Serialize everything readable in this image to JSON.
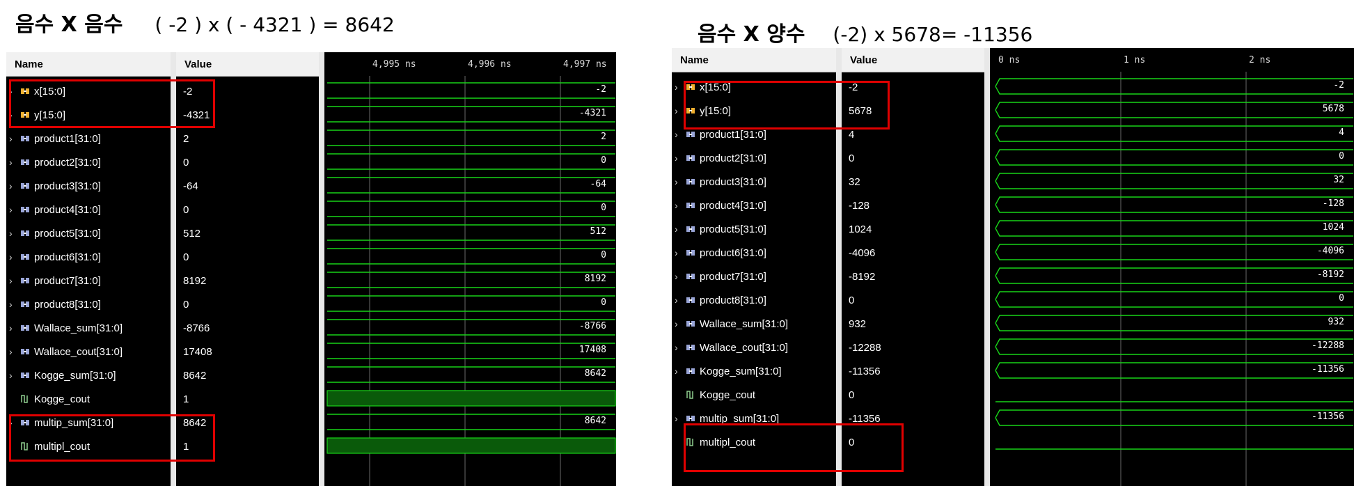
{
  "left": {
    "heading_kr": "음수 X 음수",
    "heading_eq": "( -2 ) x ( - 4321 ) = 8642",
    "columns": {
      "name": "Name",
      "value": "Value"
    },
    "ruler_labels": [
      "4,995 ns",
      "4,996 ns",
      "4,997 ns"
    ],
    "signals": [
      {
        "name": "x[15:0]",
        "value": "-2",
        "wave": "-2"
      },
      {
        "name": "y[15:0]",
        "value": "-4321",
        "wave": "-4321"
      },
      {
        "name": "product1[31:0]",
        "value": "2",
        "wave": "2"
      },
      {
        "name": "product2[31:0]",
        "value": "0",
        "wave": "0"
      },
      {
        "name": "product3[31:0]",
        "value": "-64",
        "wave": "-64"
      },
      {
        "name": "product4[31:0]",
        "value": "0",
        "wave": "0"
      },
      {
        "name": "product5[31:0]",
        "value": "512",
        "wave": "512"
      },
      {
        "name": "product6[31:0]",
        "value": "0",
        "wave": "0"
      },
      {
        "name": "product7[31:0]",
        "value": "8192",
        "wave": "8192"
      },
      {
        "name": "product8[31:0]",
        "value": "0",
        "wave": "0"
      },
      {
        "name": "Wallace_sum[31:0]",
        "value": "-8766",
        "wave": "-8766"
      },
      {
        "name": "Wallace_cout[31:0]",
        "value": "17408",
        "wave": "17408"
      },
      {
        "name": "Kogge_sum[31:0]",
        "value": "8642",
        "wave": "8642"
      },
      {
        "name": "Kogge_cout",
        "value": "1",
        "wave": ""
      },
      {
        "name": "multip_sum[31:0]",
        "value": "8642",
        "wave": "8642"
      },
      {
        "name": "multipl_cout",
        "value": "1",
        "wave": ""
      }
    ]
  },
  "right": {
    "heading_kr": "음수 X 양수",
    "heading_eq": "(-2) x 5678=  -11356",
    "columns": {
      "name": "Name",
      "value": "Value"
    },
    "ruler_labels": [
      "0 ns",
      "1 ns",
      "2 ns"
    ],
    "signals": [
      {
        "name": "x[15:0]",
        "value": "-2",
        "wave": "-2"
      },
      {
        "name": "y[15:0]",
        "value": "5678",
        "wave": "5678"
      },
      {
        "name": "product1[31:0]",
        "value": "4",
        "wave": "4"
      },
      {
        "name": "product2[31:0]",
        "value": "0",
        "wave": "0"
      },
      {
        "name": "product3[31:0]",
        "value": "32",
        "wave": "32"
      },
      {
        "name": "product4[31:0]",
        "value": "-128",
        "wave": "-128"
      },
      {
        "name": "product5[31:0]",
        "value": "1024",
        "wave": "1024"
      },
      {
        "name": "product6[31:0]",
        "value": "-4096",
        "wave": "-4096"
      },
      {
        "name": "product7[31:0]",
        "value": "-8192",
        "wave": "-8192"
      },
      {
        "name": "product8[31:0]",
        "value": "0",
        "wave": "0"
      },
      {
        "name": "Wallace_sum[31:0]",
        "value": "932",
        "wave": "932"
      },
      {
        "name": "Wallace_cout[31:0]",
        "value": "-12288",
        "wave": "-12288"
      },
      {
        "name": "Kogge_sum[31:0]",
        "value": "-11356",
        "wave": "-11356"
      },
      {
        "name": "Kogge_cout",
        "value": "0",
        "wave": ""
      },
      {
        "name": "multip_sum[31:0]",
        "value": "-11356",
        "wave": "-11356"
      },
      {
        "name": "multipl_cout",
        "value": "0",
        "wave": ""
      }
    ]
  },
  "colors": {
    "wave_green": "#18d418",
    "high_fill": "#0a5a0a",
    "highlight": "#e00000",
    "panel_bg": "#000000"
  },
  "icons": {
    "bus": "bus-signal-icon",
    "bit": "bit-signal-icon"
  }
}
